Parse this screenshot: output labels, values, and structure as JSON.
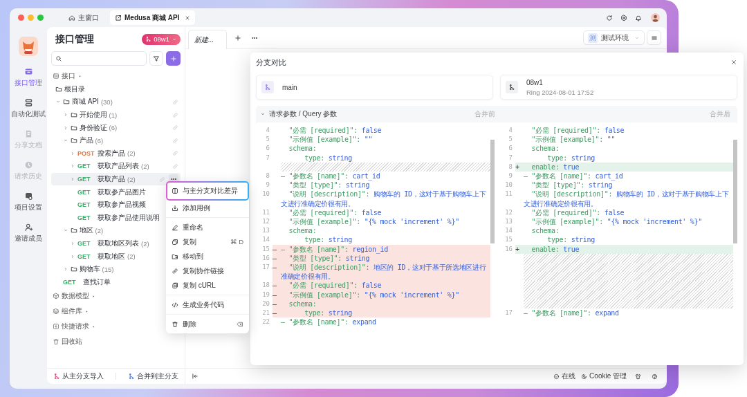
{
  "window": {
    "tabs": [
      {
        "label": "主窗口",
        "selected": false
      },
      {
        "label": "Medusa 商城 API",
        "selected": true
      }
    ]
  },
  "rail": {
    "items": [
      {
        "label": "接口管理",
        "selected": true,
        "disabled": false
      },
      {
        "label": "自动化测试",
        "selected": false,
        "disabled": false
      },
      {
        "label": "分享文档",
        "selected": false,
        "disabled": true
      },
      {
        "label": "请求历史",
        "selected": false,
        "disabled": true
      },
      {
        "label": "项目设置",
        "selected": false,
        "disabled": false
      },
      {
        "label": "邀请成员",
        "selected": false,
        "disabled": false
      }
    ]
  },
  "tree_panel": {
    "title": "接口管理",
    "branch": "08w1",
    "sections": [
      {
        "label": "接口",
        "expanded": true,
        "children": [
          {
            "kind": "root",
            "label": "根目录",
            "selected": false
          },
          {
            "kind": "folder",
            "label": "商城 API",
            "count": "(30)",
            "expanded": true,
            "selected": false,
            "link": true,
            "children": [
              {
                "kind": "folder",
                "label": "开始使用",
                "count": "(1)",
                "expanded": false,
                "selected": false,
                "link": true
              },
              {
                "kind": "folder",
                "label": "身份验证",
                "count": "(6)",
                "expanded": false,
                "selected": false,
                "link": true
              },
              {
                "kind": "folder",
                "label": "产品",
                "count": "(6)",
                "expanded": true,
                "selected": false,
                "link": true,
                "children": [
                  {
                    "kind": "api",
                    "method": "POST",
                    "color": "#e8743b",
                    "label": "搜索产品",
                    "count": "(2)",
                    "expanded": false,
                    "selected": false,
                    "link": true
                  },
                  {
                    "kind": "api",
                    "method": "GET",
                    "color": "#3cae6a",
                    "label": "获取产品列表",
                    "count": "(2)",
                    "expanded": false,
                    "selected": false,
                    "link": true
                  },
                  {
                    "kind": "api",
                    "method": "GET",
                    "color": "#3cae6a",
                    "label": "获取产品",
                    "count": "(2)",
                    "expanded": false,
                    "selected": true,
                    "link": true
                  },
                  {
                    "kind": "api",
                    "method": "GET",
                    "color": "#3cae6a",
                    "label": "获取参产品图片",
                    "selected": false
                  },
                  {
                    "kind": "api",
                    "method": "GET",
                    "color": "#3cae6a",
                    "label": "获取参产品视频",
                    "selected": false
                  },
                  {
                    "kind": "api",
                    "method": "GET",
                    "color": "#3cae6a",
                    "label": "获取参产品使用说明",
                    "selected": false
                  }
                ]
              },
              {
                "kind": "folder",
                "label": "地区",
                "count": "(2)",
                "expanded": true,
                "selected": false,
                "children": [
                  {
                    "kind": "api",
                    "method": "GET",
                    "color": "#3cae6a",
                    "label": "获取地区列表",
                    "count": "(2)",
                    "expanded": false,
                    "selected": false
                  },
                  {
                    "kind": "api",
                    "method": "GET",
                    "color": "#3cae6a",
                    "label": "获取地区",
                    "count": "(2)",
                    "expanded": false,
                    "selected": false
                  }
                ]
              },
              {
                "kind": "folder",
                "label": "购物车",
                "count": "(15)",
                "expanded": false,
                "selected": false
              }
            ]
          },
          {
            "kind": "api",
            "method": "GET",
            "color": "#3cae6a",
            "label": "查找订单",
            "selected": false
          }
        ]
      },
      {
        "label": "数据模型",
        "expanded": false
      },
      {
        "label": "组件库",
        "expanded": false
      },
      {
        "label": "快捷请求",
        "expanded": false
      },
      {
        "label": "回收站"
      }
    ],
    "footer": [
      "从主分支导入",
      "合并到主分支"
    ]
  },
  "main": {
    "tabs": [
      {
        "label": "新建...",
        "selected": true
      }
    ],
    "environment": {
      "badge": "测",
      "label": "测试环境"
    },
    "status_bar": {
      "online": "在线",
      "cookie": "Cookie 管理"
    }
  },
  "context_menu": {
    "groups": [
      [
        {
          "label": "与主分支对比差异",
          "selected": true
        },
        {
          "label": "添加用例",
          "selected": false
        }
      ],
      [
        {
          "label": "重命名",
          "selected": false
        },
        {
          "label": "复制",
          "shortcut": "⌘ D",
          "selected": false
        },
        {
          "label": "移动到",
          "selected": false
        },
        {
          "label": "复制协作链接",
          "selected": false
        },
        {
          "label": "复制 cURL",
          "selected": false
        }
      ],
      [
        {
          "label": "生成业务代码",
          "selected": false
        }
      ],
      [
        {
          "label": "删除",
          "selected": false,
          "kind": "delete"
        }
      ]
    ]
  },
  "dialog": {
    "title": "分支对比",
    "base": {
      "name": "main"
    },
    "compare": {
      "name": "08w1",
      "meta": "Ring  2024-08-01 17:52"
    },
    "section": {
      "title": "请求参数 / Query 参数",
      "expanded": true,
      "left_label": "合并前",
      "right_label": "合并后"
    },
    "left": [
      {
        "kind": "line",
        "num": "4",
        "key": "  \"必需 [required]\":",
        "value": "false"
      },
      {
        "kind": "line",
        "num": "5",
        "key": "  \"示例值 [example]\":",
        "value": "\"\""
      },
      {
        "kind": "line",
        "num": "6",
        "key": "  schema:"
      },
      {
        "kind": "line",
        "num": "7",
        "key": "      type:",
        "value": "string"
      },
      {
        "kind": "gap"
      },
      {
        "kind": "line",
        "num": "8",
        "key": "– \"参数名 [name]\":",
        "value": "cart_id"
      },
      {
        "kind": "line",
        "num": "9",
        "key": "  \"类型 [type]\":",
        "value": "string"
      },
      {
        "kind": "line",
        "num": "10",
        "key": "  \"说明 [description]\":",
        "value": "购物车的 ID，这对于基于购物车上下文进行准确定价很有用。"
      },
      {
        "kind": "line",
        "num": "11",
        "key": "  \"必需 [required]\":",
        "value": "false"
      },
      {
        "kind": "line",
        "num": "12",
        "key": "  \"示例值 [example]\":",
        "value": "\"{% mock 'increment' %}\""
      },
      {
        "kind": "line",
        "num": "13",
        "key": "  schema:"
      },
      {
        "kind": "line",
        "num": "14",
        "key": "      type:",
        "value": "string"
      },
      {
        "kind": "removed",
        "num": "15",
        "marker": "–",
        "key": "– \"参数名 [name]\":",
        "value": "region_id"
      },
      {
        "kind": "removed",
        "num": "16",
        "marker": "–",
        "key": "  \"类型 [type]\":",
        "value": "string"
      },
      {
        "kind": "removed",
        "num": "17",
        "marker": "–",
        "key": "  \"说明 [description]\":",
        "value": "地区的 ID，这对于基于所选地区进行准确定价很有用。"
      },
      {
        "kind": "removed",
        "num": "18",
        "marker": "–",
        "key": "  \"必需 [required]\":",
        "value": "false"
      },
      {
        "kind": "removed",
        "num": "19",
        "marker": "–",
        "key": "  \"示例值 [example]\":",
        "value": "\"{% mock 'increment' %}\""
      },
      {
        "kind": "removed",
        "num": "20",
        "marker": "–",
        "key": "  schema:"
      },
      {
        "kind": "removed",
        "num": "21",
        "marker": "–",
        "key": "      type:",
        "value": "string"
      },
      {
        "kind": "line",
        "num": "22",
        "key": "– \"参数名 [name]\":",
        "value": "expand"
      }
    ],
    "right": [
      {
        "kind": "line",
        "num": "4",
        "key": "  \"必需 [required]\":",
        "value": "false"
      },
      {
        "kind": "line",
        "num": "5",
        "key": "  \"示例值 [example]\":",
        "value": "\"\""
      },
      {
        "kind": "line",
        "num": "6",
        "key": "  schema:"
      },
      {
        "kind": "line",
        "num": "7",
        "key": "      type:",
        "value": "string"
      },
      {
        "kind": "added",
        "num": "8",
        "marker": "+",
        "key": "  enable:",
        "value": "true"
      },
      {
        "kind": "line",
        "num": "9",
        "key": "– \"参数名 [name]\":",
        "value": "cart_id"
      },
      {
        "kind": "line",
        "num": "10",
        "key": "  \"类型 [type]\":",
        "value": "string"
      },
      {
        "kind": "line",
        "num": "11",
        "key": "  \"说明 [description]\":",
        "value": "购物车的 ID，这对于基于购物车上下文进行准确定价很有用。"
      },
      {
        "kind": "line",
        "num": "12",
        "key": "  \"必需 [required]\":",
        "value": "false"
      },
      {
        "kind": "line",
        "num": "13",
        "key": "  \"示例值 [example]\":",
        "value": "\"{% mock 'increment' %}\""
      },
      {
        "kind": "line",
        "num": "14",
        "key": "  schema:"
      },
      {
        "kind": "line",
        "num": "15",
        "key": "      type:",
        "value": "string"
      },
      {
        "kind": "added",
        "num": "16",
        "marker": "+",
        "key": "  enable:",
        "value": "true"
      },
      {
        "kind": "gap"
      },
      {
        "kind": "gap"
      },
      {
        "kind": "gap"
      },
      {
        "kind": "gap"
      },
      {
        "kind": "gap"
      },
      {
        "kind": "gap"
      },
      {
        "kind": "line",
        "num": "17",
        "key": "– \"参数名 [name]\":",
        "value": "expand"
      }
    ]
  }
}
